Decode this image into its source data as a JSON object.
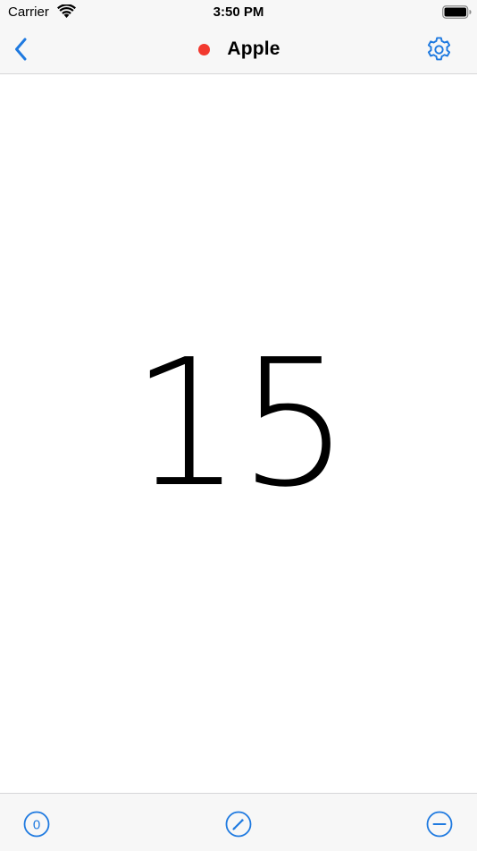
{
  "status_bar": {
    "carrier": "Carrier",
    "time": "3:50 PM",
    "icons": [
      "wifi-icon",
      "battery-icon"
    ]
  },
  "nav": {
    "title": "Apple",
    "dot_color": "#f2392f",
    "back_icon": "chevron-left-icon",
    "settings_icon": "gear-icon"
  },
  "counter": {
    "value": "15"
  },
  "toolbar": {
    "reset_icon": "reset-zero-icon",
    "reset_glyph": "0",
    "edit_icon": "pencil-icon",
    "decrement_icon": "minus-circle-icon"
  },
  "colors": {
    "accent": "#1f7ae0",
    "bar_background": "#f7f7f7",
    "separator": "#d6d6d8"
  }
}
